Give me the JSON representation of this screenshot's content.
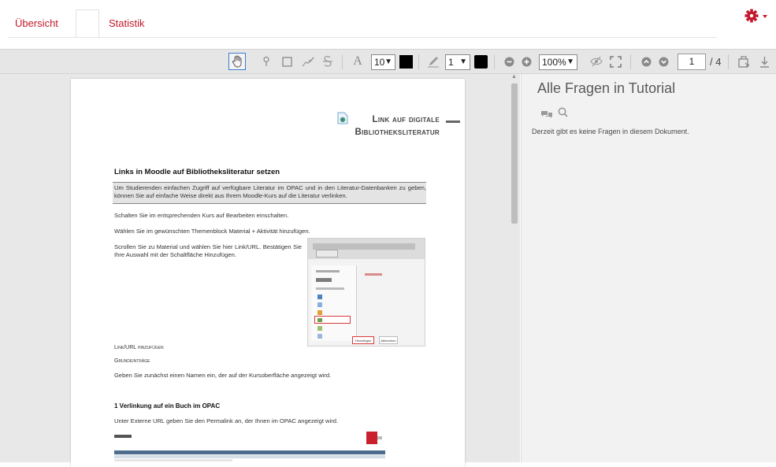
{
  "tabs": {
    "overview": "Übersicht",
    "statistics": "Statistik"
  },
  "toolbar": {
    "font_size": "10",
    "line_width": "1",
    "zoom": "100%",
    "page_current": "1",
    "page_total": "/ 4",
    "icons": [
      "hand-pan-icon",
      "location-pin-icon",
      "rectangle-icon",
      "signature-icon",
      "strikethrough-icon",
      "text-icon",
      "pen-icon",
      "zoom-out-icon",
      "zoom-in-icon",
      "hide-icon",
      "fullscreen-icon",
      "page-up-icon",
      "page-down-icon",
      "print-icon",
      "download-icon"
    ],
    "colors": {
      "accent": "#c2192c",
      "swatch": "#000000",
      "active_outline": "#3b7bd1"
    }
  },
  "document": {
    "title_line1": "Link auf digitale",
    "title_line2": "Bibliotheksliteratur",
    "heading1": "Links in Moodle auf Bibliotheksliteratur setzen",
    "intro": "Um Studierenden einfachen Zugriff auf verfügbare Literatur im OPAC und in den Literatur-Datenbanken zu geben, können Sie auf einfache Weise direkt aus Ihrem Moodle-Kurs auf die Literatur verlinken.",
    "step1": "Schalten Sie im entsprechenden Kurs auf Bearbeiten einschalten.",
    "step2": "Wählen Sie im gewünschten Themenblock Material + Aktivität hinzufügen.",
    "step3": "Scrollen Sie zu Material und wählen Sie hier Link/URL. Bestätigen Sie Ihre Auswahl mit der Schaltfläche Hinzufügen.",
    "link_url": "Link/URL hinzufügen",
    "basics": "Grundeinträge",
    "name_hint": "Geben Sie zunächst einen Namen ein, der auf der Kursoberfläche angezeigt wird.",
    "heading2": "1 Verlinkung auf ein Buch im OPAC",
    "url_hint": "Unter Externe URL geben Sie den Permalink an, der Ihnen im OPAC angezeigt wird.",
    "shot_buttons": [
      "Hinzufügen",
      "Abbrechen"
    ]
  },
  "panel": {
    "title": "Alle Fragen in Tutorial",
    "empty": "Derzeit gibt es keine Fragen in diesem Dokument.",
    "icons": [
      "comments-icon",
      "search-icon"
    ]
  }
}
